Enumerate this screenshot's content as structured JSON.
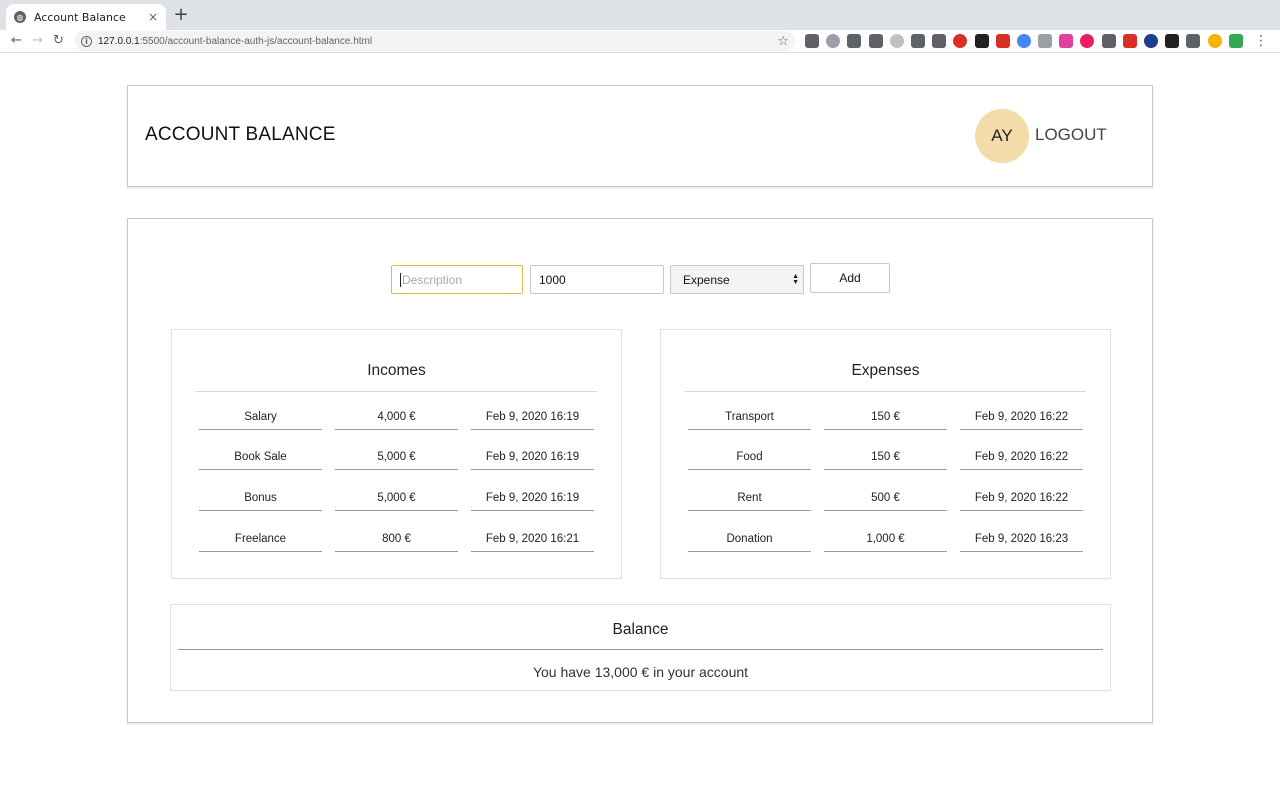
{
  "browser": {
    "tab_title": "Account Balance",
    "tab_close": "×",
    "new_tab": "+",
    "url_host": "127.0.0.1",
    "url_path": ":5500/account-balance-auth-js/account-balance.html",
    "extension_colors": [
      "#5f6368",
      "#9aa0a6",
      "#5f6368",
      "#5f6368",
      "#bdc1c6",
      "#5f6368",
      "#5f6368",
      "#d93025",
      "#202124",
      "#d93025",
      "#4285f4",
      "#9aa0a6",
      "#e040a0",
      "#e91e63",
      "#5f6368",
      "#d93025",
      "#1a3e8c",
      "#202124",
      "#5f6368",
      "#f4b400",
      "#34a853"
    ]
  },
  "header": {
    "title": "ACCOUNT BALANCE",
    "avatar_initials": "AY",
    "logout_label": "LOGOUT"
  },
  "form": {
    "description_placeholder": "Description",
    "amount_value": "1000",
    "type_selected": "Expense",
    "add_label": "Add"
  },
  "incomes": {
    "title": "Incomes",
    "rows": [
      {
        "description": "Salary",
        "amount": "4,000 €",
        "date": "Feb 9, 2020 16:19"
      },
      {
        "description": "Book Sale",
        "amount": "5,000 €",
        "date": "Feb 9, 2020 16:19"
      },
      {
        "description": "Bonus",
        "amount": "5,000 €",
        "date": "Feb 9, 2020 16:19"
      },
      {
        "description": "Freelance",
        "amount": "800 €",
        "date": "Feb 9, 2020 16:21"
      }
    ]
  },
  "expenses": {
    "title": "Expenses",
    "rows": [
      {
        "description": "Transport",
        "amount": "150 €",
        "date": "Feb 9, 2020 16:22"
      },
      {
        "description": "Food",
        "amount": "150 €",
        "date": "Feb 9, 2020 16:22"
      },
      {
        "description": "Rent",
        "amount": "500 €",
        "date": "Feb 9, 2020 16:22"
      },
      {
        "description": "Donation",
        "amount": "1,000 €",
        "date": "Feb 9, 2020 16:23"
      }
    ]
  },
  "balance": {
    "title": "Balance",
    "text": "You have 13,000 € in your account"
  },
  "colors": {
    "avatar_bg": "#f3dcaa",
    "focus_border": "#e4b843"
  }
}
